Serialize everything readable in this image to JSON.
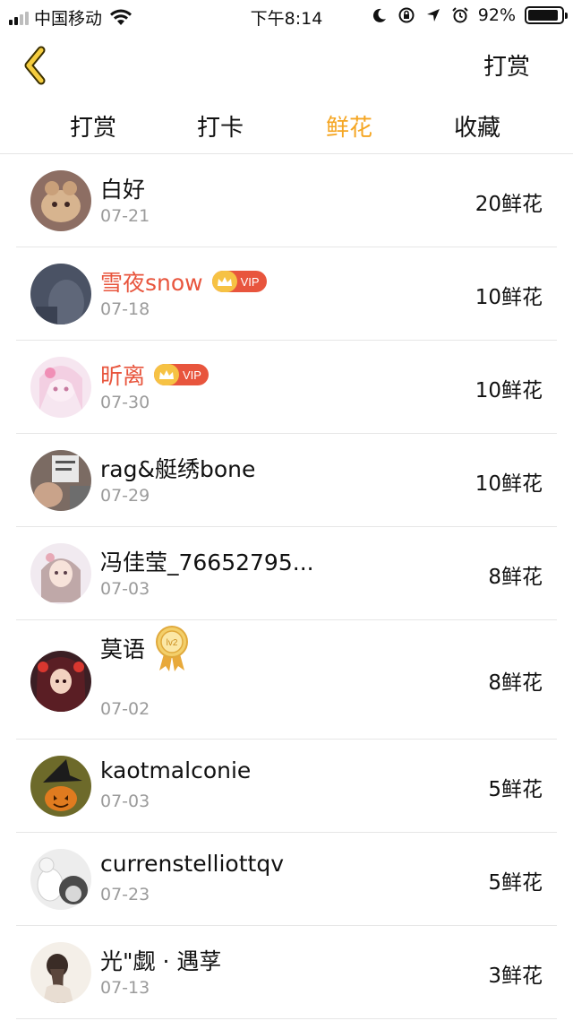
{
  "status_bar": {
    "carrier": "中国移动",
    "time": "下午8:14",
    "battery_percent": "92%",
    "battery_level": 0.92
  },
  "nav": {
    "back_icon": "chevron-left-icon",
    "action_label": "打赏"
  },
  "tabs": [
    {
      "label": "打赏",
      "active": false
    },
    {
      "label": "打卡",
      "active": false
    },
    {
      "label": "鲜花",
      "active": true
    },
    {
      "label": "收藏",
      "active": false
    }
  ],
  "accent_color": "#f5a623",
  "vip_color": "#e8553d",
  "vip_label": "VIP",
  "medal_label": "lv2",
  "list": [
    {
      "name": "白好",
      "date": "07-21",
      "amount": "20鲜花"
    },
    {
      "name": "雪夜snow",
      "date": "07-18",
      "amount": "10鲜花"
    },
    {
      "name": "昕离",
      "date": "07-30",
      "amount": "10鲜花"
    },
    {
      "name": "rag&艇绣bone",
      "date": "07-29",
      "amount": "10鲜花"
    },
    {
      "name": "冯佳莹_76652795...",
      "date": "07-03",
      "amount": "8鲜花"
    },
    {
      "name": "莫语",
      "date": "07-02",
      "amount": "8鲜花"
    },
    {
      "name": "kaotmalconie",
      "date": "07-03",
      "amount": "5鲜花"
    },
    {
      "name": "currenstelliottqv",
      "date": "07-23",
      "amount": "5鲜花"
    },
    {
      "name": "光\"觑 · 遇莩",
      "date": "07-13",
      "amount": "3鲜花"
    }
  ]
}
